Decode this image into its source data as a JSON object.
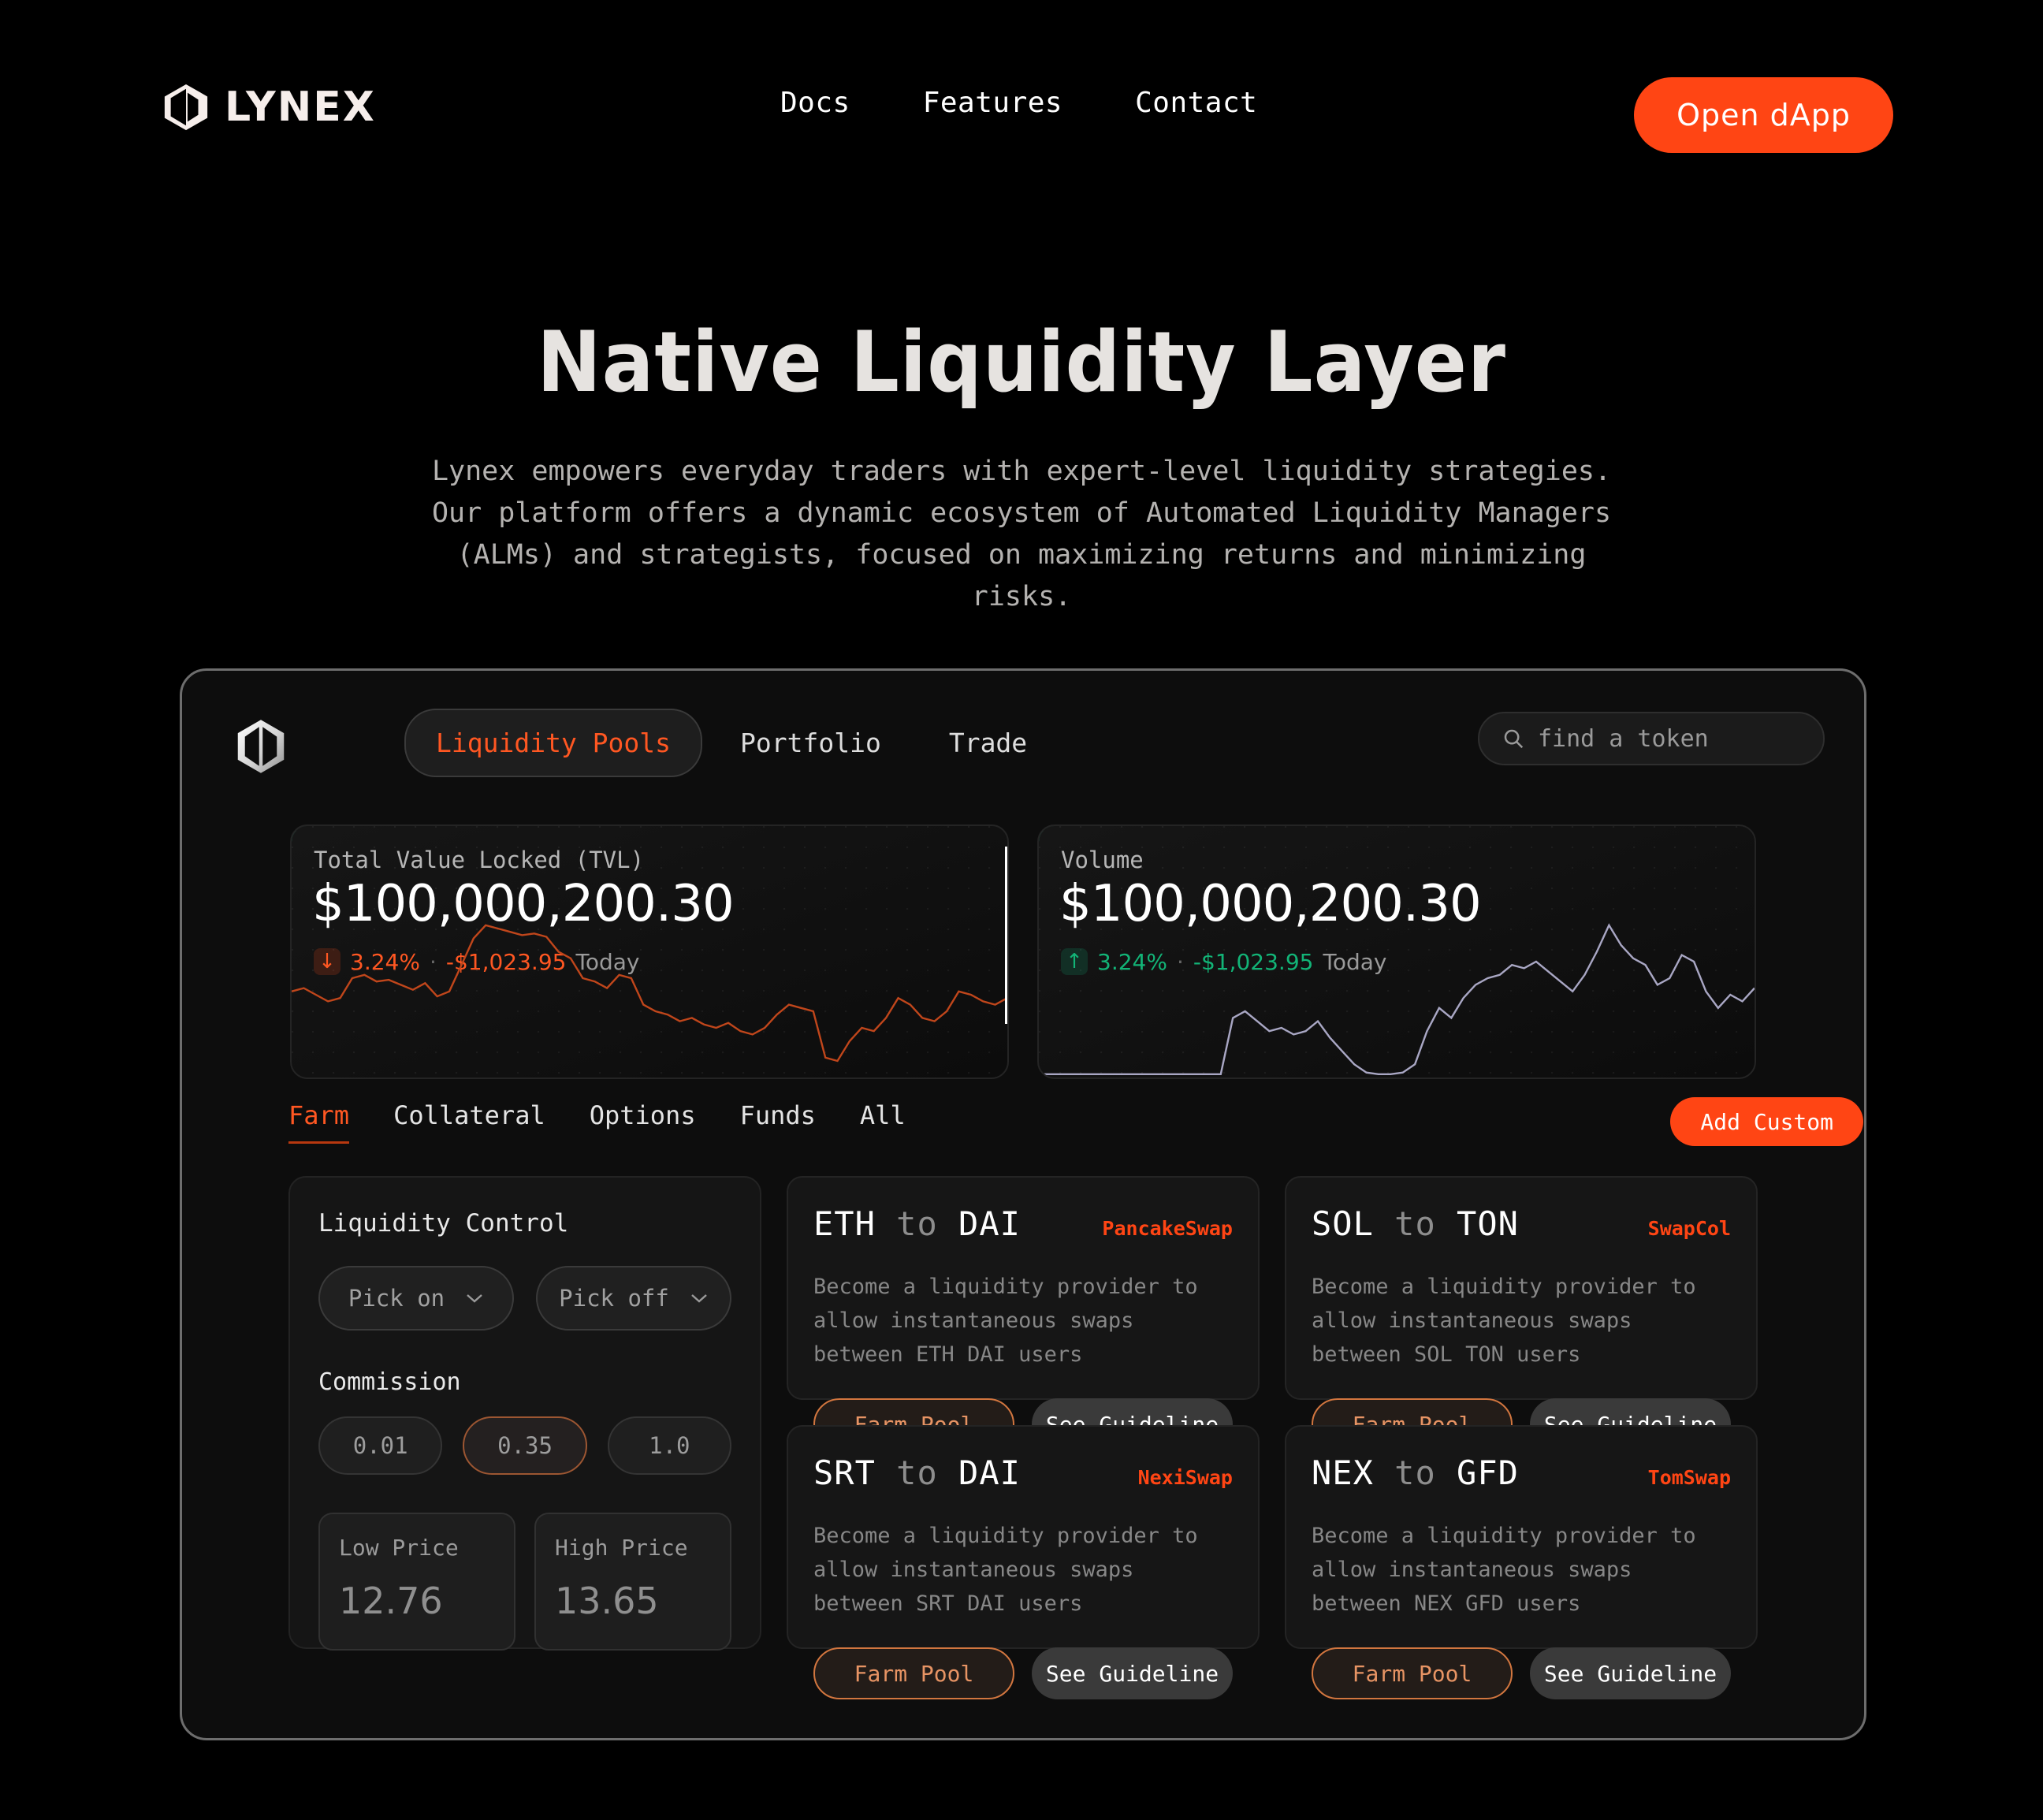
{
  "brand": {
    "name": "LYNEX",
    "logo_icon": "lynex-hex-icon"
  },
  "nav": {
    "links": [
      {
        "label": "Docs"
      },
      {
        "label": "Features"
      },
      {
        "label": "Contact"
      }
    ],
    "cta_label": "Open dApp",
    "cta_color": "#FF4514"
  },
  "hero": {
    "title": "Native Liquidity Layer",
    "subtitle": "Lynex empowers everyday traders with expert-level liquidity strategies. Our platform offers a dynamic ecosystem of Automated Liquidity Managers (ALMs) and strategists, focused on maximizing returns and minimizing risks."
  },
  "app": {
    "logo_icon": "lynex-hex-icon",
    "tabs": [
      {
        "label": "Liquidity Pools",
        "active": true
      },
      {
        "label": "Portfolio",
        "active": false
      },
      {
        "label": "Trade",
        "active": false
      }
    ],
    "search": {
      "placeholder": "find a token",
      "value": "",
      "icon": "search-icon"
    },
    "stats": [
      {
        "label": "Total Value Locked (TVL)",
        "value": "$100,000,200.30",
        "direction": "down",
        "arrow": "↓",
        "percent": "3.24%",
        "amount": "-$1,023.95",
        "period": "Today",
        "color": "#FF5722"
      },
      {
        "label": "Volume",
        "value": "$100,000,200.30",
        "direction": "up",
        "arrow": "↑",
        "percent": "3.24%",
        "amount": "-$1,023.95",
        "period": "Today",
        "color": "#12B477"
      }
    ],
    "filters": [
      {
        "label": "Farm",
        "active": true
      },
      {
        "label": "Collateral",
        "active": false
      },
      {
        "label": "Options",
        "active": false
      },
      {
        "label": "Funds",
        "active": false
      },
      {
        "label": "All",
        "active": false
      }
    ],
    "add_custom_label": "Add Custom",
    "liquidity_control": {
      "title": "Liquidity Control",
      "pick_on_label": "Pick on",
      "pick_off_label": "Pick off",
      "commission_title": "Commission",
      "commission_options": [
        {
          "value": "0.01",
          "selected": false
        },
        {
          "value": "0.35",
          "selected": true
        },
        {
          "value": "1.0",
          "selected": false
        }
      ],
      "low_price_label": "Low Price",
      "low_price_value": "12.76",
      "high_price_label": "High Price",
      "high_price_value": "13.65"
    },
    "pools": [
      {
        "from": "ETH",
        "to": "to",
        "target": "DAI",
        "dex": "PancakeSwap",
        "description": "Become a liquidity provider to allow instantaneous swaps between ETH DAI users",
        "farm_label": "Farm Pool",
        "guide_label": "See Guideline"
      },
      {
        "from": "SOL",
        "to": "to",
        "target": "TON",
        "dex": "SwapCol",
        "description": "Become a liquidity provider to allow instantaneous swaps between SOL TON users",
        "farm_label": "Farm Pool",
        "guide_label": "See Guideline"
      },
      {
        "from": "SRT",
        "to": "to",
        "target": "DAI",
        "dex": "NexiSwap",
        "description": "Become a liquidity provider to allow instantaneous swaps between SRT DAI users",
        "farm_label": "Farm Pool",
        "guide_label": "See Guideline"
      },
      {
        "from": "NEX",
        "to": "to",
        "target": "GFD",
        "dex": "TomSwap",
        "description": "Become a liquidity provider to allow instantaneous swaps between NEX GFD users",
        "farm_label": "Farm Pool",
        "guide_label": "See Guideline"
      }
    ]
  },
  "chart_data": [
    {
      "type": "line",
      "title": "Total Value Locked (TVL)",
      "series": [
        {
          "name": "TVL",
          "values": [
            52,
            54,
            50,
            46,
            48,
            60,
            62,
            58,
            59,
            56,
            53,
            57,
            49,
            52,
            68,
            84,
            92,
            90,
            88,
            86,
            87,
            85,
            76,
            72,
            60,
            58,
            54,
            62,
            60,
            44,
            40,
            38,
            34,
            36,
            32,
            30,
            33,
            28,
            26,
            30,
            38,
            44,
            42,
            40,
            12,
            10,
            22,
            30,
            28,
            36,
            48,
            44,
            36,
            34,
            40,
            52,
            50,
            46,
            44,
            48
          ]
        }
      ],
      "color": "#C0461B",
      "xlabel": "",
      "ylabel": "",
      "grid": false,
      "legend": false
    },
    {
      "type": "line",
      "title": "Volume",
      "series": [
        {
          "name": "Volume",
          "values": [
            2,
            2,
            2,
            2,
            2,
            2,
            2,
            2,
            2,
            2,
            2,
            2,
            2,
            2,
            2,
            2,
            36,
            40,
            34,
            28,
            30,
            26,
            28,
            34,
            24,
            16,
            8,
            3,
            2,
            2,
            3,
            8,
            28,
            42,
            36,
            48,
            56,
            60,
            62,
            68,
            66,
            70,
            64,
            58,
            52,
            62,
            76,
            92,
            80,
            72,
            68,
            56,
            60,
            74,
            70,
            52,
            42,
            50,
            46,
            54
          ]
        }
      ],
      "color": "#A9A7C4",
      "xlabel": "",
      "ylabel": "",
      "grid": false,
      "legend": false
    }
  ]
}
